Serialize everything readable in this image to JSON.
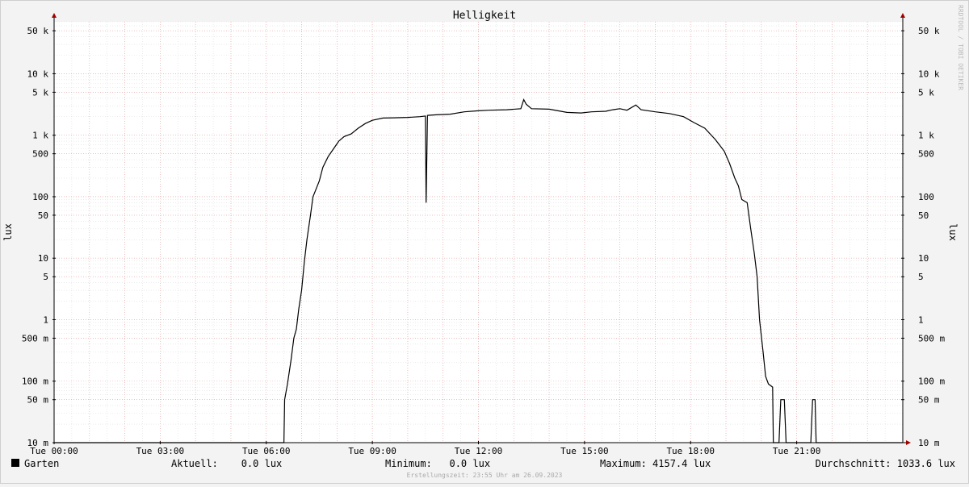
{
  "chart_data": {
    "type": "line",
    "title": "Helligkeit",
    "ylabel": "lux",
    "ylabel_right": "lux",
    "watermark": "RRDTOOL / TOBI OETIKER",
    "y_scale": "log",
    "ylim": [
      0.01,
      70000
    ],
    "xlim_hours": [
      0,
      24
    ],
    "x_ticks": [
      {
        "hour": 0,
        "label": "Tue 00:00"
      },
      {
        "hour": 3,
        "label": "Tue 03:00"
      },
      {
        "hour": 6,
        "label": "Tue 06:00"
      },
      {
        "hour": 9,
        "label": "Tue 09:00"
      },
      {
        "hour": 12,
        "label": "Tue 12:00"
      },
      {
        "hour": 15,
        "label": "Tue 15:00"
      },
      {
        "hour": 18,
        "label": "Tue 18:00"
      },
      {
        "hour": 21,
        "label": "Tue 21:00"
      }
    ],
    "y_ticks": [
      {
        "value": 50000,
        "label": "50 k"
      },
      {
        "value": 10000,
        "label": "10 k"
      },
      {
        "value": 5000,
        "label": "5 k"
      },
      {
        "value": 1000,
        "label": "1 k"
      },
      {
        "value": 500,
        "label": "500"
      },
      {
        "value": 100,
        "label": "100"
      },
      {
        "value": 50,
        "label": "50"
      },
      {
        "value": 10,
        "label": "10"
      },
      {
        "value": 5,
        "label": "5"
      },
      {
        "value": 1,
        "label": "1"
      },
      {
        "value": 0.5,
        "label": "500 m"
      },
      {
        "value": 0.1,
        "label": "100 m"
      },
      {
        "value": 0.05,
        "label": "50 m"
      },
      {
        "value": 0.01,
        "label": "10 m"
      }
    ],
    "series": [
      {
        "name": "Garten",
        "color": "#000000",
        "points": [
          [
            0,
            0.01
          ],
          [
            6.5,
            0.01
          ],
          [
            6.52,
            0.05
          ],
          [
            6.6,
            0.09
          ],
          [
            6.7,
            0.22
          ],
          [
            6.78,
            0.5
          ],
          [
            6.85,
            0.7
          ],
          [
            6.92,
            1.5
          ],
          [
            7.0,
            3
          ],
          [
            7.08,
            9
          ],
          [
            7.15,
            20
          ],
          [
            7.25,
            50
          ],
          [
            7.32,
            100
          ],
          [
            7.4,
            130
          ],
          [
            7.5,
            180
          ],
          [
            7.6,
            300
          ],
          [
            7.75,
            450
          ],
          [
            7.9,
            600
          ],
          [
            8.05,
            800
          ],
          [
            8.2,
            950
          ],
          [
            8.4,
            1050
          ],
          [
            8.6,
            1300
          ],
          [
            8.8,
            1550
          ],
          [
            9.0,
            1750
          ],
          [
            9.3,
            1900
          ],
          [
            9.6,
            1920
          ],
          [
            10.0,
            1950
          ],
          [
            10.35,
            2000
          ],
          [
            10.5,
            2050
          ],
          [
            10.52,
            80
          ],
          [
            10.56,
            2100
          ],
          [
            10.8,
            2150
          ],
          [
            11.2,
            2200
          ],
          [
            11.6,
            2400
          ],
          [
            12.0,
            2500
          ],
          [
            12.3,
            2550
          ],
          [
            12.8,
            2600
          ],
          [
            13.2,
            2700
          ],
          [
            13.28,
            3800
          ],
          [
            13.35,
            3200
          ],
          [
            13.5,
            2700
          ],
          [
            14.0,
            2650
          ],
          [
            14.5,
            2350
          ],
          [
            14.9,
            2300
          ],
          [
            15.2,
            2400
          ],
          [
            15.6,
            2450
          ],
          [
            15.8,
            2600
          ],
          [
            16.0,
            2700
          ],
          [
            16.2,
            2550
          ],
          [
            16.45,
            3100
          ],
          [
            16.6,
            2600
          ],
          [
            17.0,
            2400
          ],
          [
            17.4,
            2250
          ],
          [
            17.8,
            2000
          ],
          [
            18.1,
            1600
          ],
          [
            18.4,
            1300
          ],
          [
            18.7,
            850
          ],
          [
            18.95,
            550
          ],
          [
            19.1,
            350
          ],
          [
            19.25,
            200
          ],
          [
            19.35,
            150
          ],
          [
            19.45,
            90
          ],
          [
            19.6,
            80
          ],
          [
            19.7,
            30
          ],
          [
            19.8,
            12
          ],
          [
            19.88,
            5
          ],
          [
            19.95,
            1
          ],
          [
            20.05,
            0.3
          ],
          [
            20.12,
            0.12
          ],
          [
            20.2,
            0.09
          ],
          [
            20.32,
            0.08
          ],
          [
            20.34,
            0.01
          ],
          [
            20.5,
            0.01
          ],
          [
            20.55,
            0.05
          ],
          [
            20.65,
            0.05
          ],
          [
            20.7,
            0.01
          ],
          [
            21.4,
            0.01
          ],
          [
            21.45,
            0.05
          ],
          [
            21.52,
            0.05
          ],
          [
            21.55,
            0.01
          ],
          [
            24,
            0.01
          ]
        ]
      }
    ],
    "legend": {
      "name": "Garten",
      "color": "#000000",
      "aktuell": "Aktuell:    0.0 lux",
      "minimum": "Minimum:   0.0 lux",
      "maximum": "Maximum: 4157.4 lux",
      "durchschnitt": "Durchschnitt: 1033.6 lux"
    },
    "footer": "Erstellungszeit: 23:55 Uhr am 26.09.2023",
    "grid": true
  }
}
